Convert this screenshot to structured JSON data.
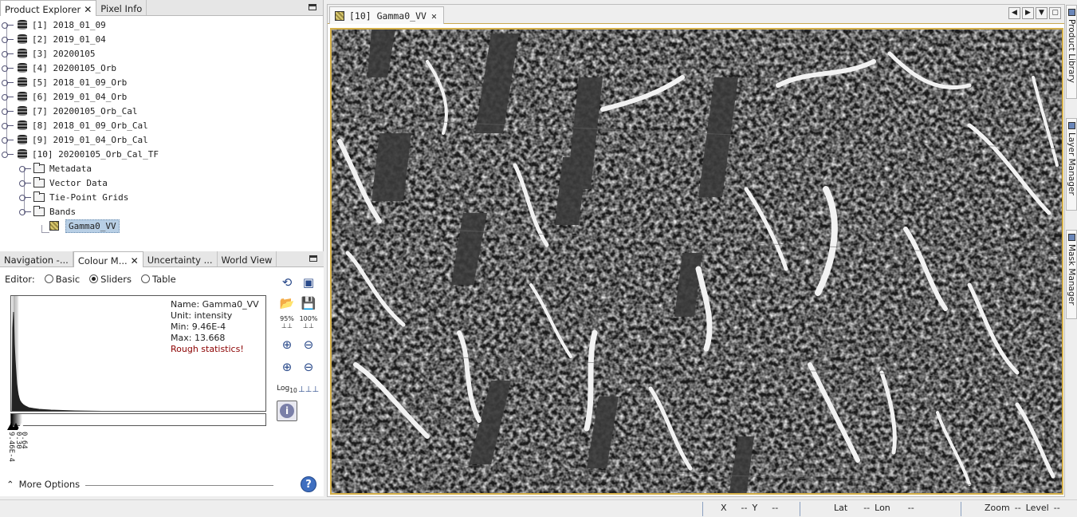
{
  "product_explorer": {
    "tabs": [
      "Product Explorer",
      "Pixel Info"
    ],
    "close_glyph": "✕",
    "products": [
      "[1] 2018_01_09",
      "[2] 2019_01_04",
      "[3] 20200105",
      "[4] 20200105_Orb",
      "[5] 2018_01_09_Orb",
      "[6] 2019_01_04_Orb",
      "[7] 20200105_Orb_Cal",
      "[8] 2018_01_09_Orb_Cal",
      "[9] 2019_01_04_Orb_Cal",
      "[10] 20200105_Orb_Cal_TF"
    ],
    "children": [
      "Metadata",
      "Vector Data",
      "Tie-Point Grids",
      "Bands"
    ],
    "band": "Gamma0_VV"
  },
  "bottom_panel": {
    "tabs": [
      "Navigation -...",
      "Colour M...",
      "Uncertainty ...",
      "World View"
    ],
    "close_glyph": "✕",
    "editor_label": "Editor:",
    "editor_options": [
      "Basic",
      "Sliders",
      "Table"
    ],
    "editor_selected": "Sliders",
    "info": {
      "name": "Name: Gamma0_VV",
      "unit": "Unit: intensity",
      "min": "Min: 9.46E-4",
      "max": "Max: 13.668",
      "warning": "Rough statistics!"
    },
    "slider_labels": [
      "9.46E-4",
      "0.30",
      "0.64"
    ],
    "tool_labels": {
      "zoom95": "95%",
      "zoom100": "100%",
      "log": "Log",
      "log_sub": "10"
    },
    "more_options": "More Options",
    "help": "?",
    "info_button": "i"
  },
  "image_view": {
    "tab_label": "[10] Gamma0_VV",
    "close_glyph": "✕",
    "nav_glyphs": [
      "◀",
      "▶",
      "▼",
      "▢"
    ]
  },
  "side_tabs": [
    "Product Library",
    "Layer Manager",
    "Mask Manager"
  ],
  "status": {
    "x_label": "X",
    "x_val": "--",
    "y_label": "Y",
    "y_val": "--",
    "lat_label": "Lat",
    "lat_val": "--",
    "lon_label": "Lon",
    "lon_val": "--",
    "zoom_label": "Zoom",
    "zoom_val": "--",
    "level_label": "Level",
    "level_val": "--"
  }
}
